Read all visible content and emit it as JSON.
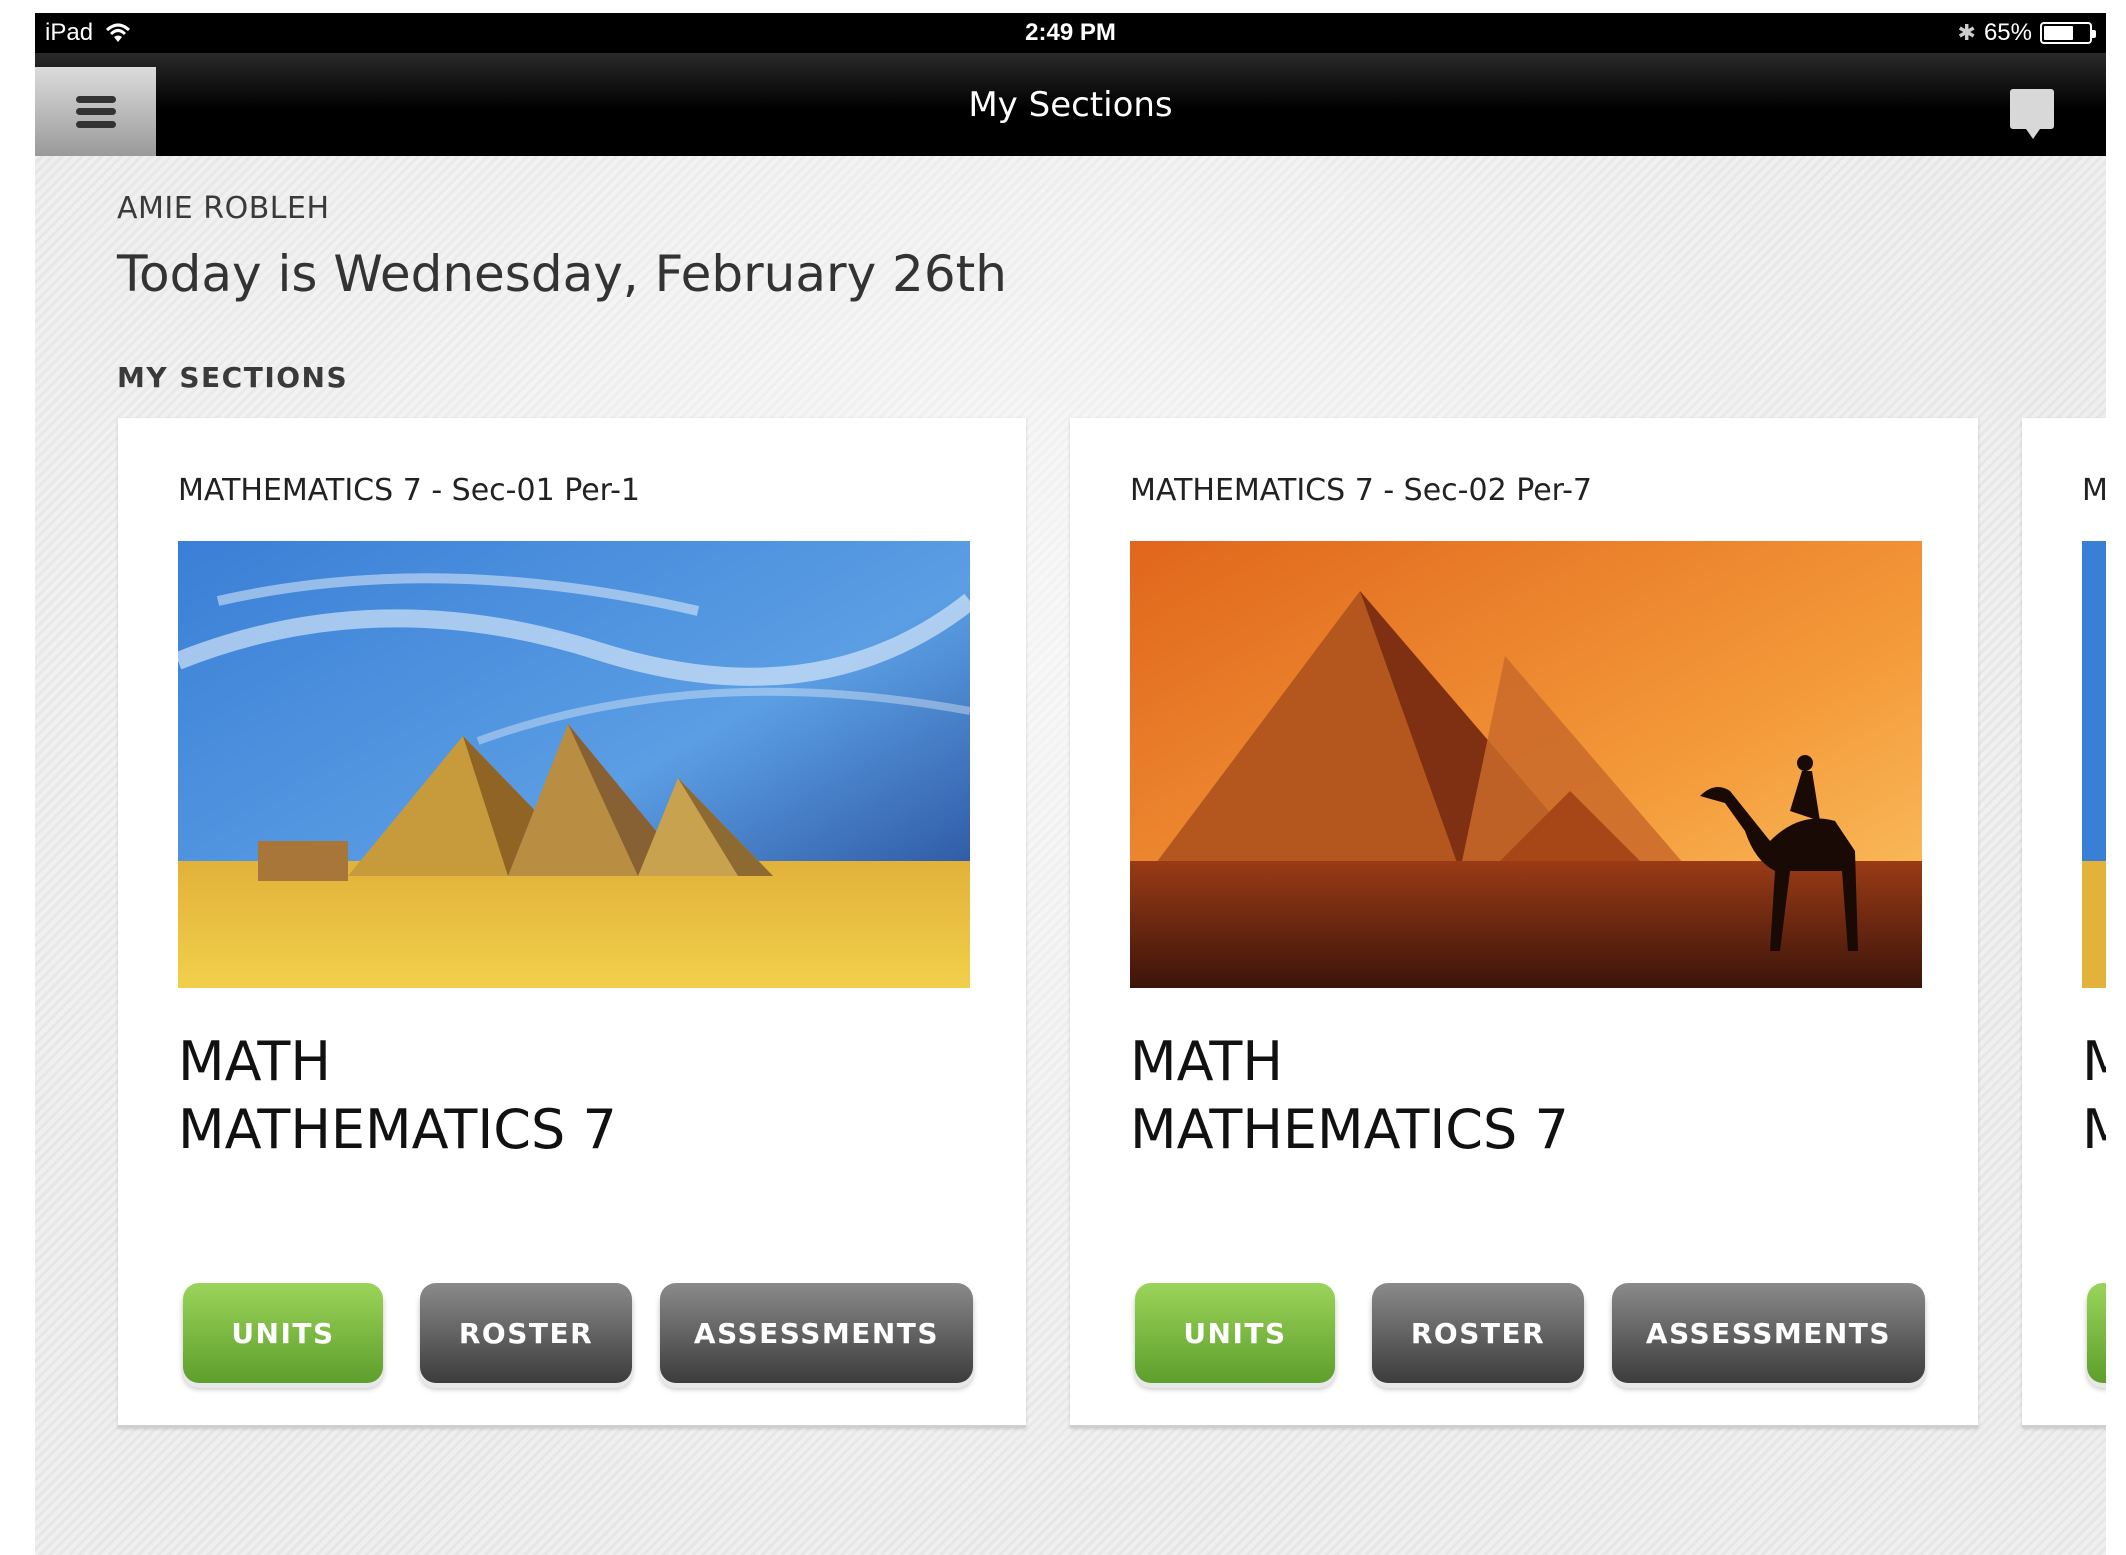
{
  "status_bar": {
    "device": "iPad",
    "time": "2:49 PM",
    "battery_percent": "65%",
    "battery_level": 0.65,
    "icons": [
      "wifi-icon",
      "bluetooth-icon",
      "battery-icon"
    ]
  },
  "nav": {
    "title": "My Sections",
    "menu_icon": "hamburger-icon",
    "chat_icon": "chat-icon"
  },
  "header": {
    "user_name": "AMIE ROBLEH",
    "today": "Today is Wednesday, February 26th",
    "section_heading": "MY SECTIONS"
  },
  "colors": {
    "units_green": "#7ab842",
    "button_gray": "#5a5a5a",
    "nav_black": "#000000"
  },
  "sections": [
    {
      "label": "MATHEMATICS 7 - Sec-01 Per-1",
      "subject": "MATH",
      "course": "MATHEMATICS 7",
      "buttons": {
        "units": "UNITS",
        "roster": "ROSTER",
        "assessments": "ASSESSMENTS"
      }
    },
    {
      "label": "MATHEMATICS 7 - Sec-02 Per-7",
      "subject": "MATH",
      "course": "MATHEMATICS 7",
      "buttons": {
        "units": "UNITS",
        "roster": "ROSTER",
        "assessments": "ASSESSMENTS"
      }
    },
    {
      "label": "MA",
      "subject": "M",
      "course": "M",
      "buttons": {
        "units": "",
        "roster": "",
        "assessments": ""
      }
    }
  ]
}
